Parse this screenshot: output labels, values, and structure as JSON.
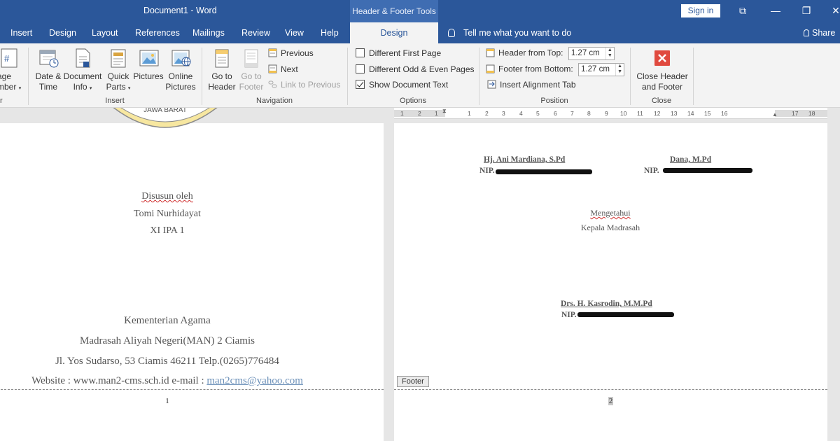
{
  "titlebar": {
    "document_title": "Document1 - Word",
    "contextual_title": "Header & Footer Tools",
    "signin_label": "Sign in",
    "ribbon_display_glyph": "⧉",
    "minimize_glyph": "—",
    "restore_glyph": "❐",
    "close_glyph": "✕"
  },
  "tabs": [
    {
      "label": "Insert"
    },
    {
      "label": "Design"
    },
    {
      "label": "Layout"
    },
    {
      "label": "References"
    },
    {
      "label": "Mailings"
    },
    {
      "label": "Review"
    },
    {
      "label": "View"
    },
    {
      "label": "Help"
    },
    {
      "label": "Design",
      "active": true
    }
  ],
  "tellme": {
    "label": "Tell me what you want to do"
  },
  "share": {
    "label": "Share"
  },
  "ribbon": {
    "partial_group": {
      "line1": "age",
      "line2": "mber",
      "label": "r"
    },
    "insert_group": {
      "label": "Insert",
      "date_time": {
        "line1": "Date &",
        "line2": "Time"
      },
      "document_info": {
        "line1": "Document",
        "line2": "Info"
      },
      "quick_parts": {
        "line1": "Quick",
        "line2": "Parts"
      },
      "pictures": {
        "line1": "Pictures"
      },
      "online_pictures": {
        "line1": "Online",
        "line2": "Pictures"
      }
    },
    "navigation_group": {
      "label": "Navigation",
      "goto_header": {
        "line1": "Go to",
        "line2": "Header"
      },
      "goto_footer": {
        "line1": "Go to",
        "line2": "Footer"
      },
      "previous": "Previous",
      "next": "Next",
      "link_to_previous": "Link to Previous"
    },
    "options_group": {
      "label": "Options",
      "different_first_page": {
        "label": "Different First Page",
        "checked": false
      },
      "different_odd_even": {
        "label": "Different Odd & Even Pages",
        "checked": false
      },
      "show_document_text": {
        "label": "Show Document Text",
        "checked": true
      }
    },
    "position_group": {
      "label": "Position",
      "header_from_top": {
        "label": "Header from Top:",
        "value": "1.27 cm"
      },
      "footer_from_bottom": {
        "label": "Footer from Bottom:",
        "value": "1.27 cm"
      },
      "insert_alignment_tab": "Insert Alignment Tab"
    },
    "close_group": {
      "label": "Close",
      "close_header_footer": {
        "line1": "Close Header",
        "line2": "and Footer"
      }
    }
  },
  "ruler": {
    "labels": [
      "1",
      "2",
      "1",
      "1",
      "2",
      "3",
      "4",
      "5",
      "6",
      "7",
      "8",
      "9",
      "10",
      "11",
      "12",
      "13",
      "14",
      "15",
      "16",
      "17",
      "18"
    ]
  },
  "page1": {
    "logo_text": "JAWA BARAT",
    "disusun_oleh": "Disusun oleh",
    "author": "Tomi Nurhidayat",
    "class": "XI IPA 1",
    "org_line1": "Kementerian Agama",
    "org_line2": "Madrasah Aliyah Negeri(MAN) 2 Ciamis",
    "address": "Jl. Yos Sudarso, 53 Ciamis 46211 Telp.(0265)776484",
    "website_prefix": "Website : www.man2-cms.sch.id e-mail : ",
    "email": "man2cms@yahoo.com",
    "page_number": "1"
  },
  "page2": {
    "sig_left_name": "Hj. Ani Mardiana, S.Pd",
    "sig_left_nip": "NIP.",
    "sig_right_name": "Dana, M.Pd",
    "sig_right_nip": "NIP.",
    "mengetahui": "Mengetahui",
    "kepala": "Kepala Madrasah",
    "head_name": "Drs. H. Kasrodin, M.M.Pd",
    "head_nip": "NIP.",
    "footer_tag": "Footer",
    "page_number": "2"
  }
}
